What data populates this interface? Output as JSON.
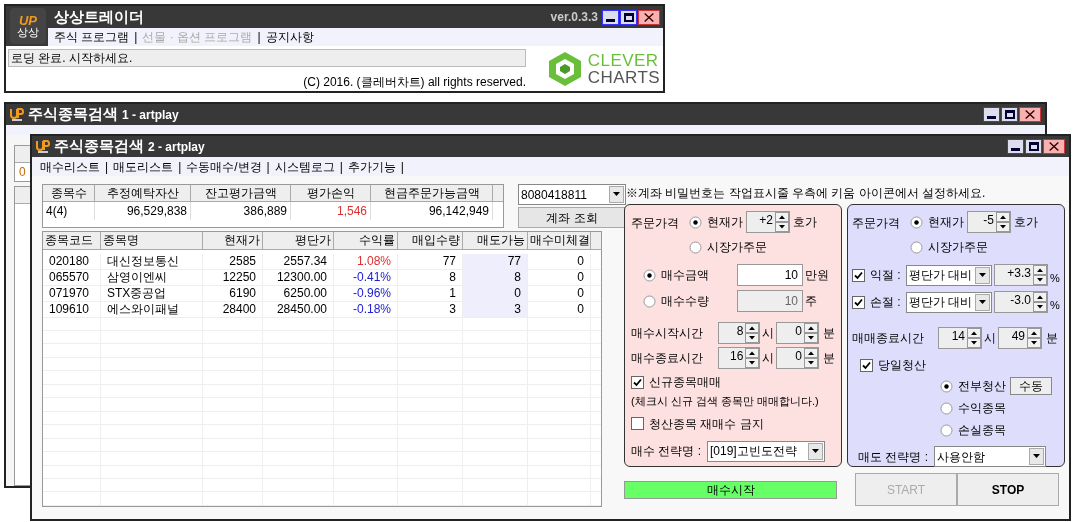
{
  "main_window": {
    "title": "상상트레이더",
    "version": "ver.0.3.3",
    "logo_mark": "UP",
    "logo_caption": "상상",
    "menu": [
      {
        "label": "주식 프로그램",
        "disabled": false,
        "separator": "|"
      },
      {
        "label": "선물 · 옵션 프로그램",
        "disabled": true,
        "separator": "|"
      },
      {
        "label": "공지사항",
        "disabled": false
      }
    ],
    "status": "로딩 완료. 시작하세요.",
    "copyright": "(C) 2016. (클레버차트) all rights reserved.",
    "brand_top": "CLEVER",
    "brand_bottom": "CHARTS"
  },
  "search_window_1": {
    "title": "주식종목검색",
    "subtitle": "1 - artplay",
    "summary_value": "0"
  },
  "search_window_2": {
    "title": "주식종목검색",
    "subtitle": "2 - artplay",
    "menu": [
      {
        "label": "매수리스트",
        "separator": "|"
      },
      {
        "label": "매도리스트",
        "separator": "|"
      },
      {
        "label": "수동매수/변경",
        "separator": "|"
      },
      {
        "label": "시스템로그",
        "separator": "|"
      },
      {
        "label": "추가기능",
        "separator": "|"
      }
    ],
    "summary": {
      "columns": [
        "종목수",
        "추정예탁자산",
        "잔고평가금액",
        "평가손익",
        "현금주문가능금액"
      ],
      "values": [
        {
          "text": "4(4)",
          "color": "#000000"
        },
        {
          "text": "96,529,838",
          "color": "#000000"
        },
        {
          "text": "386,889",
          "color": "#000000"
        },
        {
          "text": "1,546",
          "color": "#e03030"
        },
        {
          "text": "96,142,949",
          "color": "#000000"
        }
      ]
    },
    "account": "8080418811",
    "account_button": "계좌 조회",
    "holdings": {
      "columns": [
        "종목코드",
        "종목명",
        "현재가",
        "평단가",
        "수익률",
        "매입수량",
        "매도가능",
        "매수미체결"
      ],
      "rows": [
        {
          "code": "020180",
          "name": "대신정보통신",
          "price": "2585",
          "avg": "2557.34",
          "rate": "1.08%",
          "color": "#e03030",
          "qty": "77",
          "sellable": "77",
          "pending": "0"
        },
        {
          "code": "065570",
          "name": "삼영이엔씨",
          "price": "12250",
          "avg": "12300.00",
          "rate": "-0.41%",
          "color": "#2020d0",
          "qty": "8",
          "sellable": "8",
          "pending": "0"
        },
        {
          "code": "071970",
          "name": "STX중공업",
          "price": "6190",
          "avg": "6250.00",
          "rate": "-0.96%",
          "color": "#2020d0",
          "qty": "1",
          "sellable": "0",
          "pending": "0"
        },
        {
          "code": "109610",
          "name": "에스와이패널",
          "price": "28400",
          "avg": "28450.00",
          "rate": "-0.18%",
          "color": "#2020d0",
          "qty": "3",
          "sellable": "3",
          "pending": "0"
        }
      ]
    },
    "notice": "※계좌 비밀번호는 작업표시줄 우측에 키움 아이콘에서 설정하세요.",
    "buy_panel": {
      "price_label": "주문가격",
      "price_options": [
        {
          "label": "현재가",
          "selected": true
        },
        {
          "label": "시장가주문",
          "selected": false
        }
      ],
      "tick": {
        "value": "+2",
        "unit": "호가"
      },
      "amount_options": [
        {
          "label": "매수금액",
          "selected": true,
          "value": "10",
          "unit": "만원",
          "disabled": false
        },
        {
          "label": "매수수량",
          "selected": false,
          "value": "10",
          "unit": "주",
          "disabled": true
        }
      ],
      "start_time": {
        "label": "매수시작시간",
        "hour": "8",
        "hour_unit": "시",
        "minute": "0",
        "minute_unit": "분"
      },
      "end_time": {
        "label": "매수종료시간",
        "hour": "16",
        "hour_unit": "시",
        "minute": "0",
        "minute_unit": "분"
      },
      "new_only": {
        "label": "신규종목매매",
        "checked": true
      },
      "note": "(체크시 신규 검색 종목만 매매합니다.)",
      "no_rebuy": {
        "label": "청산종목 재매수 금지",
        "checked": false
      },
      "strategy": {
        "label": "매수 전략명 :",
        "value": "[019]고빈도전략"
      }
    },
    "sell_panel": {
      "price_label": "주문가격",
      "price_options": [
        {
          "label": "현재가",
          "selected": true
        },
        {
          "label": "시장가주문",
          "selected": false
        }
      ],
      "tick": {
        "value": "-5",
        "unit": "호가"
      },
      "limits": [
        {
          "label": "익절 :",
          "checked": true,
          "mode": "평단가 대비",
          "value": "+3.3",
          "unit": "%"
        },
        {
          "label": "손절 :",
          "checked": true,
          "mode": "평단가 대비",
          "value": "-3.0",
          "unit": "%"
        }
      ],
      "end_time": {
        "label": "매매종료시간",
        "hour": "14",
        "hour_unit": "시",
        "minute": "49",
        "minute_unit": "분"
      },
      "liquidate": {
        "label": "당일청산",
        "checked": true
      },
      "liquidate_options": [
        {
          "label": "전부청산",
          "selected": true
        },
        {
          "label": "수익종목",
          "selected": false
        },
        {
          "label": "손실종목",
          "selected": false
        }
      ],
      "manual_button": "수동",
      "strategy": {
        "label": "매도 전략명 :",
        "value": "사용안함"
      }
    },
    "status_bar": {
      "text": "매수시작",
      "level": 1
    },
    "buttons": [
      {
        "label": "START",
        "disabled": true
      },
      {
        "label": "STOP",
        "disabled": false
      }
    ]
  }
}
